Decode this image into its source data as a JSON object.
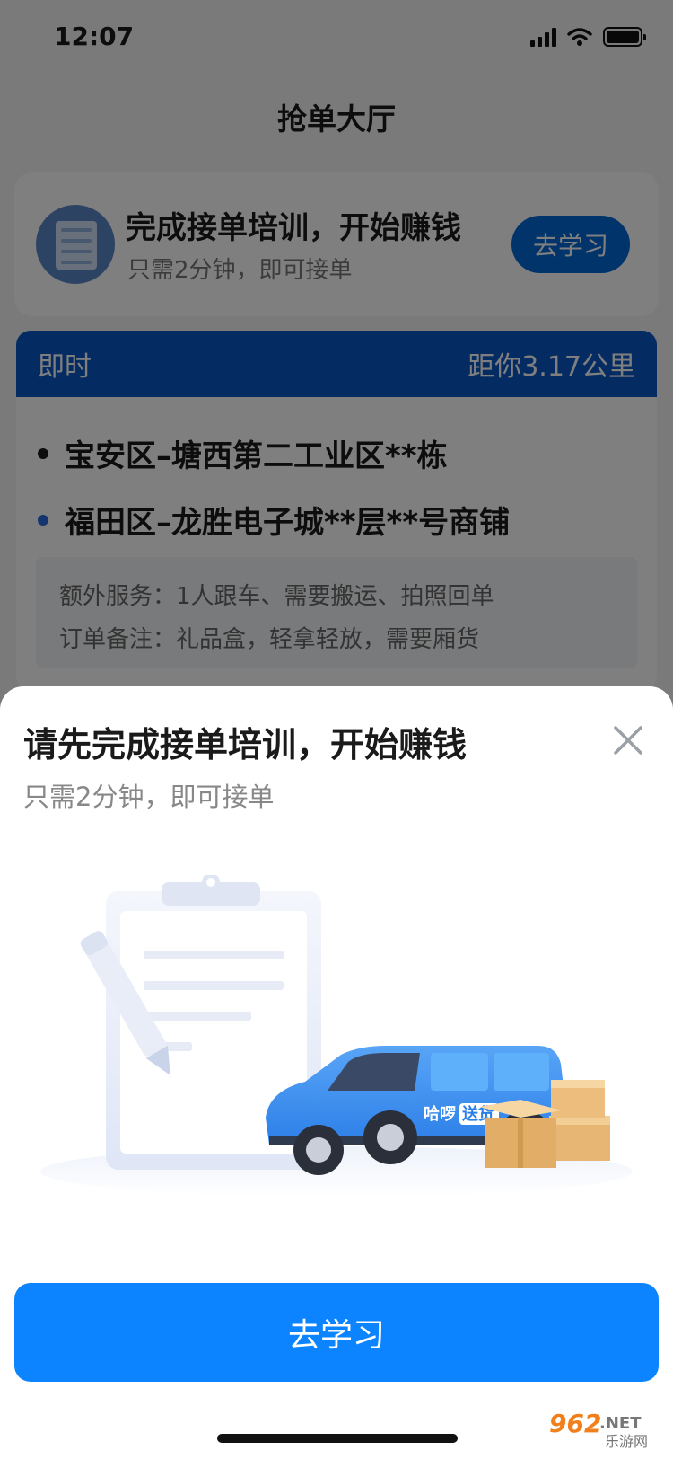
{
  "status_bar": {
    "time": "12:07"
  },
  "page": {
    "title": "抢单大厅"
  },
  "promo": {
    "title": "完成接单培训，开始赚钱",
    "subtitle": "只需2分钟，即可接单",
    "button": "去学习"
  },
  "order": {
    "type": "即时",
    "distance": "距你3.17公里",
    "from": "宝安区–塘西第二工业区**栋",
    "to": "福田区–龙胜电子城**层**号商铺",
    "extra_services": "额外服务：1人跟车、需要搬运、拍照回单",
    "note": "订单备注：礼品盒，轻拿轻放，需要厢货"
  },
  "sheet": {
    "title": "请先完成接单培训，开始赚钱",
    "subtitle": "只需2分钟，即可接单",
    "van_brand": "哈啰",
    "van_tag": "送货",
    "cta": "去学习"
  },
  "watermark": {
    "main": "962",
    "suffix": ".NET",
    "sub": "乐游网"
  },
  "colors": {
    "primary": "#0c84ff",
    "header_blue": "#0b58c4",
    "from_dot": "#1a1a1a",
    "to_dot": "#2a6be0"
  }
}
